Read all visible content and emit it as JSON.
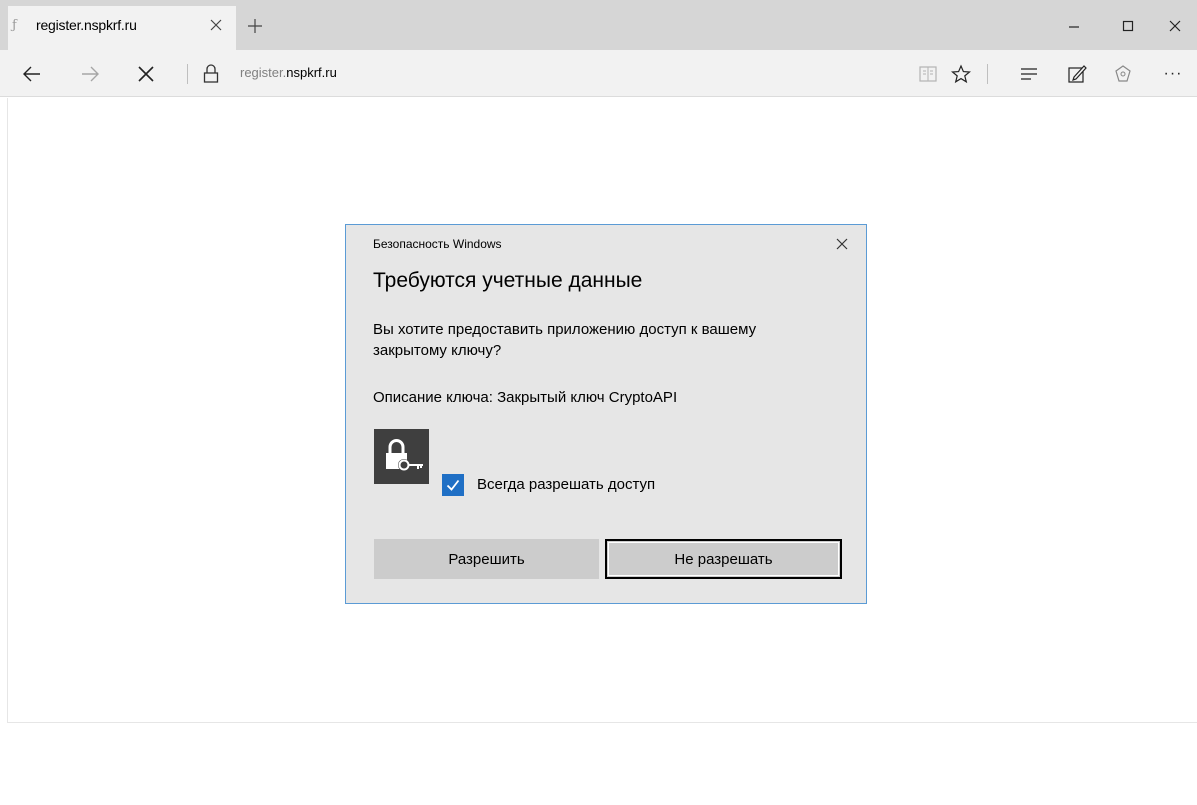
{
  "browser": {
    "tab": {
      "title": "register.nspkrf.ru",
      "favicon_glyph": "ƒ"
    },
    "address": {
      "url_prefix": "register.",
      "url_domain": "nspkrf.ru"
    },
    "icons": {
      "back": "arrow-left-icon",
      "forward": "arrow-right-icon",
      "stop": "close-icon",
      "lock": "lock-icon",
      "reading_view": "book-icon",
      "favorites": "star-icon",
      "hub": "hub-icon",
      "web_note": "pen-icon",
      "share": "share-icon",
      "more": "more-icon"
    },
    "more_glyph": "···"
  },
  "dialog": {
    "caption": "Безопасность Windows",
    "heading": "Требуются учетные данные",
    "message": "Вы хотите предоставить приложению доступ к вашему закрытому ключу?",
    "description": "Описание ключа: Закрытый ключ CryptoAPI",
    "checkbox": {
      "label": "Всегда разрешать доступ",
      "checked": true
    },
    "buttons": {
      "allow": "Разрешить",
      "deny": "Не разрешать"
    },
    "colors": {
      "border": "#5b9bd5",
      "checkbox": "#1f6fc5",
      "background": "#e6e6e6"
    }
  }
}
